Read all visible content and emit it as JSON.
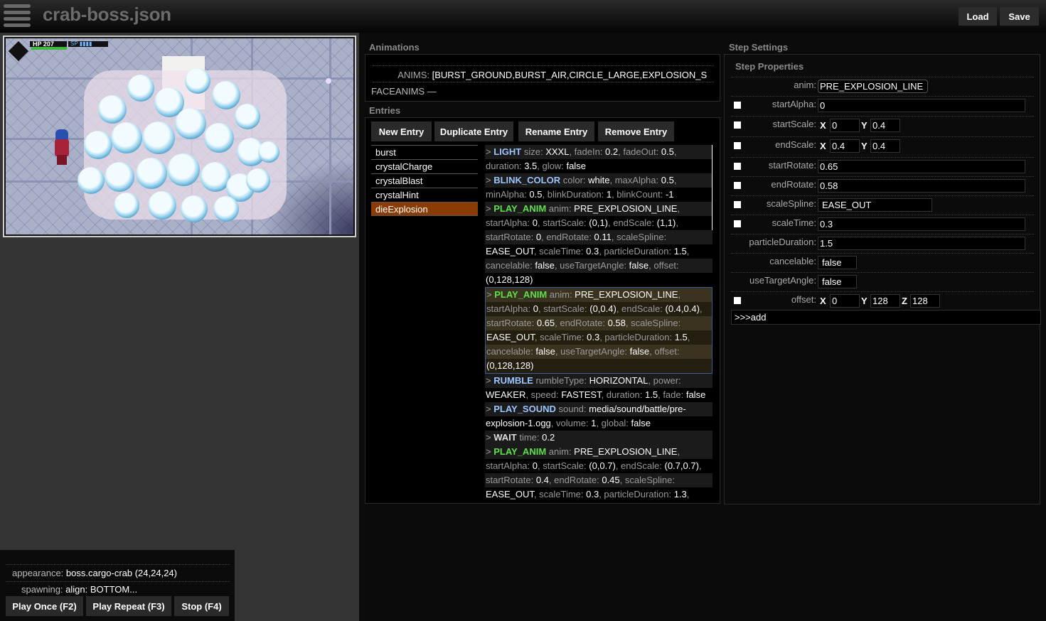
{
  "header": {
    "title": "crab-boss.json",
    "load_label": "Load",
    "save_label": "Save"
  },
  "preview": {
    "hud": {
      "hp_label": "HP",
      "hp_value": "207",
      "sp_label": "SP"
    }
  },
  "bottom_panel": {
    "appearance_label": "appearance:",
    "appearance_value": "boss.cargo-crab (24,24,24)",
    "spawning_label": "spawning:",
    "spawning_key": "align:",
    "spawning_value": "BOTTOM...",
    "play_once_label": "Play Once (F2)",
    "play_repeat_label": "Play Repeat (F3)",
    "stop_label": "Stop (F4)"
  },
  "animations": {
    "section_title": "Animations",
    "anims_label": "ANIMS:",
    "anims_value": "[BURST_GROUND,BURST_AIR,CIRCLE_LARGE,EXPLOSION_S",
    "faceanims_label": "FACEANIMS —"
  },
  "entries": {
    "section_title": "Entries",
    "buttons": {
      "new": "New Entry",
      "duplicate": "Duplicate Entry",
      "rename": "Rename Entry",
      "remove": "Remove Entry"
    },
    "items": [
      {
        "name": "burst",
        "selected": false
      },
      {
        "name": "crystalCharge",
        "selected": false
      },
      {
        "name": "crystalBlast",
        "selected": false
      },
      {
        "name": "crystalHint",
        "selected": false
      },
      {
        "name": "dieExplosion",
        "selected": true
      }
    ],
    "steps": [
      {
        "type": "LIGHT",
        "color": "blue",
        "selected": false,
        "lines": [
          [
            [
              "k",
              "> "
            ],
            [
              "t",
              "LIGHT"
            ],
            [
              "k",
              " size: "
            ],
            [
              "v",
              "XXXL"
            ],
            [
              "k",
              ", fadeIn: "
            ],
            [
              "v",
              "0.2"
            ],
            [
              "k",
              ", fadeOut: "
            ],
            [
              "v",
              "0.5"
            ],
            [
              "k",
              ","
            ]
          ],
          [
            [
              "k",
              "duration: "
            ],
            [
              "v",
              "3.5"
            ],
            [
              "k",
              ", glow: "
            ],
            [
              "v",
              "false"
            ]
          ]
        ]
      },
      {
        "type": "BLINK_COLOR",
        "color": "blue",
        "selected": false,
        "lines": [
          [
            [
              "k",
              "> "
            ],
            [
              "t",
              "BLINK_COLOR"
            ],
            [
              "k",
              " color: "
            ],
            [
              "v",
              "white"
            ],
            [
              "k",
              ", maxAlpha: "
            ],
            [
              "v",
              "0.5"
            ],
            [
              "k",
              ","
            ]
          ],
          [
            [
              "k",
              "minAlpha: "
            ],
            [
              "v",
              "0.5"
            ],
            [
              "k",
              ", blinkDuration: "
            ],
            [
              "v",
              "1"
            ],
            [
              "k",
              ", blinkCount: "
            ],
            [
              "v",
              "-1"
            ]
          ]
        ]
      },
      {
        "type": "PLAY_ANIM",
        "color": "green",
        "selected": false,
        "lines": [
          [
            [
              "k",
              "> "
            ],
            [
              "t",
              "PLAY_ANIM"
            ],
            [
              "k",
              " anim: "
            ],
            [
              "v",
              "PRE_EXPLOSION_LINE"
            ],
            [
              "k",
              ","
            ]
          ],
          [
            [
              "k",
              "startAlpha: "
            ],
            [
              "v",
              "0"
            ],
            [
              "k",
              ", startScale: "
            ],
            [
              "v",
              "(0,1)"
            ],
            [
              "k",
              ", endScale: "
            ],
            [
              "v",
              "(1,1)"
            ],
            [
              "k",
              ","
            ]
          ],
          [
            [
              "k",
              "startRotate: "
            ],
            [
              "v",
              "0"
            ],
            [
              "k",
              ", endRotate: "
            ],
            [
              "v",
              "0.11"
            ],
            [
              "k",
              ", scaleSpline:"
            ]
          ],
          [
            [
              "v",
              "EASE_OUT"
            ],
            [
              "k",
              ", scaleTime: "
            ],
            [
              "v",
              "0.3"
            ],
            [
              "k",
              ", particleDuration: "
            ],
            [
              "v",
              "1.5"
            ],
            [
              "k",
              ","
            ]
          ],
          [
            [
              "k",
              "cancelable: "
            ],
            [
              "v",
              "false"
            ],
            [
              "k",
              ", useTargetAngle: "
            ],
            [
              "v",
              "false"
            ],
            [
              "k",
              ", offset:"
            ]
          ],
          [
            [
              "v",
              "(0,128,128)"
            ]
          ]
        ]
      },
      {
        "type": "PLAY_ANIM",
        "color": "green",
        "selected": true,
        "lines": [
          [
            [
              "k",
              "> "
            ],
            [
              "t",
              "PLAY_ANIM"
            ],
            [
              "k",
              " anim: "
            ],
            [
              "v",
              "PRE_EXPLOSION_LINE"
            ],
            [
              "k",
              ","
            ]
          ],
          [
            [
              "k",
              "startAlpha: "
            ],
            [
              "v",
              "0"
            ],
            [
              "k",
              ", startScale: "
            ],
            [
              "v",
              "(0,0.4)"
            ],
            [
              "k",
              ", endScale: "
            ],
            [
              "v",
              "(0.4,0.4)"
            ],
            [
              "k",
              ","
            ]
          ],
          [
            [
              "k",
              "startRotate: "
            ],
            [
              "v",
              "0.65"
            ],
            [
              "k",
              ", endRotate: "
            ],
            [
              "v",
              "0.58"
            ],
            [
              "k",
              ", scaleSpline:"
            ]
          ],
          [
            [
              "v",
              "EASE_OUT"
            ],
            [
              "k",
              ", scaleTime: "
            ],
            [
              "v",
              "0.3"
            ],
            [
              "k",
              ", particleDuration: "
            ],
            [
              "v",
              "1.5"
            ],
            [
              "k",
              ","
            ]
          ],
          [
            [
              "k",
              "cancelable: "
            ],
            [
              "v",
              "false"
            ],
            [
              "k",
              ", useTargetAngle: "
            ],
            [
              "v",
              "false"
            ],
            [
              "k",
              ", offset:"
            ]
          ],
          [
            [
              "v",
              "(0,128,128)"
            ]
          ]
        ]
      },
      {
        "type": "RUMBLE",
        "color": "blue",
        "selected": false,
        "lines": [
          [
            [
              "k",
              "> "
            ],
            [
              "t",
              "RUMBLE"
            ],
            [
              "k",
              " rumbleType: "
            ],
            [
              "v",
              "HORIZONTAL"
            ],
            [
              "k",
              ", power:"
            ]
          ],
          [
            [
              "v",
              "WEAKER"
            ],
            [
              "k",
              ", speed: "
            ],
            [
              "v",
              "FASTEST"
            ],
            [
              "k",
              ", duration: "
            ],
            [
              "v",
              "1.5"
            ],
            [
              "k",
              ", fade: "
            ],
            [
              "v",
              "false"
            ]
          ]
        ]
      },
      {
        "type": "PLAY_SOUND",
        "color": "blue",
        "selected": false,
        "lines": [
          [
            [
              "k",
              "> "
            ],
            [
              "t",
              "PLAY_SOUND"
            ],
            [
              "k",
              " sound: "
            ],
            [
              "v",
              "media/sound/battle/pre-"
            ]
          ],
          [
            [
              "v",
              "explosion-1.ogg"
            ],
            [
              "k",
              ", volume: "
            ],
            [
              "v",
              "1"
            ],
            [
              "k",
              ", global: "
            ],
            [
              "v",
              "false"
            ]
          ]
        ]
      },
      {
        "type": "WAIT",
        "color": "white",
        "selected": false,
        "lines": [
          [
            [
              "k",
              "> "
            ],
            [
              "t",
              "WAIT"
            ],
            [
              "k",
              " time: "
            ],
            [
              "v",
              "0.2"
            ]
          ]
        ]
      },
      {
        "type": "PLAY_ANIM",
        "color": "green",
        "selected": false,
        "lines": [
          [
            [
              "k",
              "> "
            ],
            [
              "t",
              "PLAY_ANIM"
            ],
            [
              "k",
              " anim: "
            ],
            [
              "v",
              "PRE_EXPLOSION_LINE"
            ],
            [
              "k",
              ","
            ]
          ],
          [
            [
              "k",
              "startAlpha: "
            ],
            [
              "v",
              "0"
            ],
            [
              "k",
              ", startScale: "
            ],
            [
              "v",
              "(0,0.7)"
            ],
            [
              "k",
              ", endScale: "
            ],
            [
              "v",
              "(0.7,0.7)"
            ],
            [
              "k",
              ","
            ]
          ],
          [
            [
              "k",
              "startRotate: "
            ],
            [
              "v",
              "0.4"
            ],
            [
              "k",
              ", endRotate: "
            ],
            [
              "v",
              "0.45"
            ],
            [
              "k",
              ", scaleSpline:"
            ]
          ],
          [
            [
              "v",
              "EASE_OUT"
            ],
            [
              "k",
              ", scaleTime: "
            ],
            [
              "v",
              "0.3"
            ],
            [
              "k",
              ", particleDuration: "
            ],
            [
              "v",
              "1.3"
            ],
            [
              "k",
              ","
            ]
          ]
        ]
      }
    ]
  },
  "step_settings": {
    "section_title": "Step Settings",
    "properties_title": "Step Properties",
    "anim_label": "anim:",
    "anim_value": "PRE_EXPLOSION_LINE",
    "startAlpha_label": "startAlpha:",
    "startAlpha_value": "0",
    "startScale_label": "startScale:",
    "startScale_x": "0",
    "startScale_y": "0.4",
    "endScale_label": "endScale:",
    "endScale_x": "0.4",
    "endScale_y": "0.4",
    "startRotate_label": "startRotate:",
    "startRotate_value": "0.65",
    "endRotate_label": "endRotate:",
    "endRotate_value": "0.58",
    "scaleSpline_label": "scaleSpline:",
    "scaleSpline_value": "EASE_OUT",
    "scaleTime_label": "scaleTime:",
    "scaleTime_value": "0.3",
    "particleDuration_label": "particleDuration:",
    "particleDuration_value": "1.5",
    "cancelable_label": "cancelable:",
    "cancelable_value": "false",
    "useTargetAngle_label": "useTargetAngle:",
    "useTargetAngle_value": "false",
    "offset_label": "offset:",
    "offset_x": "0",
    "offset_y": "128",
    "offset_z": "128",
    "axis_x": "X",
    "axis_y": "Y",
    "axis_z": "Z",
    "add_label": ">>>add"
  },
  "colors": {
    "selected_entry": "#8a3c04",
    "keyword_blue": "#9cc5ff",
    "keyword_green": "#5ee04c"
  }
}
